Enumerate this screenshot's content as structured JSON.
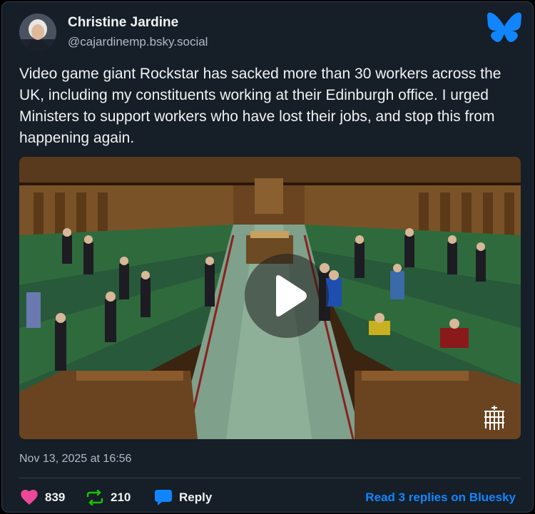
{
  "author": {
    "display_name": "Christine Jardine",
    "handle": "@cajardinemp.bsky.social"
  },
  "post": {
    "text": "Video game giant Rockstar has sacked more than 30 workers across the UK, including my constituents working at their Edinburgh office. I urged Ministers to support workers who have lost their jobs, and stop this from happening again.",
    "timestamp": "Nov 13, 2025 at 16:56"
  },
  "video": {
    "thumbnail": "House of Commons chamber",
    "play_icon": "play-icon",
    "watermark_icon": "portcullis-icon"
  },
  "stats": {
    "likes": "839",
    "reposts": "210",
    "reply_label": "Reply"
  },
  "footer": {
    "read_replies": "Read 3 replies on Bluesky"
  },
  "colors": {
    "background": "#161e27",
    "text": "#f1f3f5",
    "muted": "#aebbc9",
    "accent": "#1185fe",
    "like": "#ec4899",
    "repost": "#20bc07"
  }
}
